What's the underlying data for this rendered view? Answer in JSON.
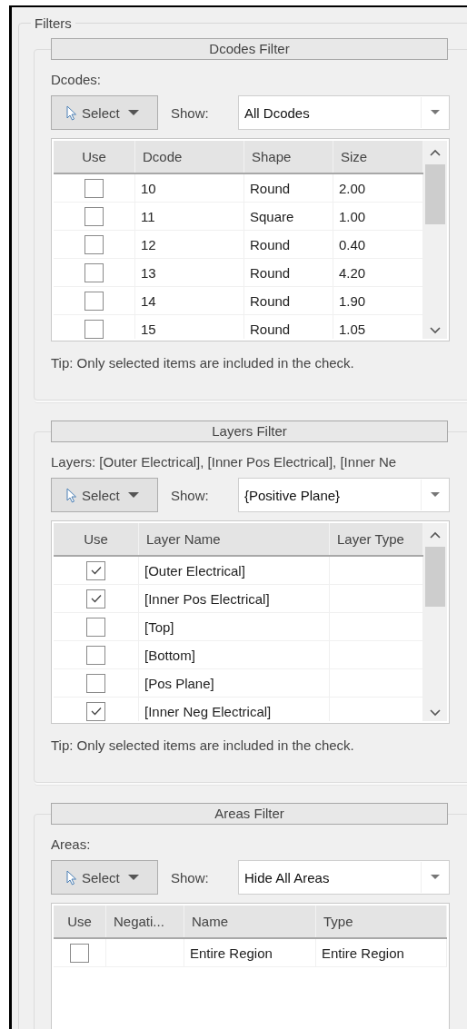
{
  "group": {
    "title": "Filters"
  },
  "sections": [
    {
      "header": "Dcodes Filter",
      "label": "Dcodes:",
      "select_button": "Select",
      "show_label": "Show:",
      "show_value": "All Dcodes",
      "table": {
        "use_column": "Use",
        "columns": [
          "Dcode",
          "Shape",
          "Size"
        ],
        "rows": [
          {
            "use": false,
            "cells": [
              "10",
              "Round",
              "2.00"
            ]
          },
          {
            "use": false,
            "cells": [
              "11",
              "Square",
              "1.00"
            ]
          },
          {
            "use": false,
            "cells": [
              "12",
              "Round",
              "0.40"
            ]
          },
          {
            "use": false,
            "cells": [
              "13",
              "Round",
              "4.20"
            ]
          },
          {
            "use": false,
            "cells": [
              "14",
              "Round",
              "1.90"
            ]
          },
          {
            "use": false,
            "cells": [
              "15",
              "Round",
              "1.05"
            ]
          }
        ]
      },
      "tip": "Tip: Only selected items are included in the check."
    },
    {
      "header": "Layers Filter",
      "label": "Layers: [Outer Electrical], [Inner Pos Electrical], [Inner Ne",
      "select_button": "Select",
      "show_label": "Show:",
      "show_value": "{Positive Plane}",
      "table": {
        "use_column": "Use",
        "columns": [
          "Layer Name",
          "Layer Type"
        ],
        "rows": [
          {
            "use": true,
            "cells": [
              "[Outer Electrical]"
            ]
          },
          {
            "use": true,
            "cells": [
              "[Inner Pos Electrical]"
            ]
          },
          {
            "use": false,
            "cells": [
              "[Top]"
            ]
          },
          {
            "use": false,
            "cells": [
              "[Bottom]"
            ]
          },
          {
            "use": false,
            "cells": [
              "[Pos Plane]"
            ]
          },
          {
            "use": true,
            "cells": [
              "[Inner Neg Electrical]"
            ]
          }
        ]
      },
      "tip": "Tip: Only selected items are included in the check."
    },
    {
      "header": "Areas Filter",
      "label": "Areas:",
      "select_button": "Select",
      "show_label": "Show:",
      "show_value": "Hide All Areas",
      "table": {
        "use_column": "Use",
        "columns": [
          "Negati...",
          "Name",
          "Type"
        ],
        "rows": [
          {
            "use": false,
            "cells": [
              null,
              "Entire Region",
              "Entire Region"
            ]
          }
        ]
      }
    }
  ]
}
